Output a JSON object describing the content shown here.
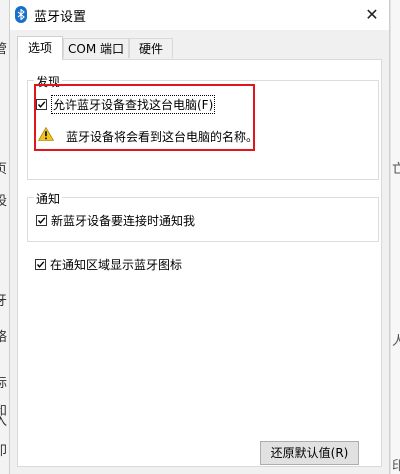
{
  "background": {
    "left_chars": [
      "管",
      "页",
      "设",
      "牙",
      "络",
      "标",
      "和",
      "入",
      "印"
    ],
    "right_chars": [
      "亡",
      "人",
      "印"
    ]
  },
  "dialog": {
    "title": "蓝牙设置",
    "close_label": "✕",
    "tabs": [
      {
        "label": "选项",
        "active": true
      },
      {
        "label": "COM 端口",
        "active": false
      },
      {
        "label": "硬件",
        "active": false
      }
    ],
    "discovery": {
      "group_label": "发现",
      "allow_discover_label": "允许蓝牙设备查找这台电脑(F)",
      "allow_discover_checked": true,
      "warning_text": "蓝牙设备将会看到这台电脑的名称。"
    },
    "notification": {
      "group_label": "通知",
      "notify_new_device_label": "新蓝牙设备要连接时通知我",
      "notify_new_device_checked": true
    },
    "show_tray_icon_label": "在通知区域显示蓝牙图标",
    "show_tray_icon_checked": true,
    "restore_defaults_label": "还原默认值(R)"
  },
  "colors": {
    "highlight_border": "#e0161a",
    "bluetooth_icon": "#1a6fc9",
    "warning": "#f0c419"
  }
}
